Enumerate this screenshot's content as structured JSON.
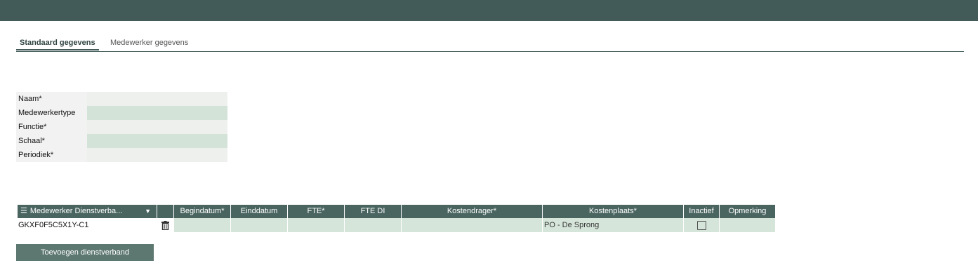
{
  "tabs": [
    {
      "label": "Standaard gegevens",
      "active": true
    },
    {
      "label": "Medewerker gegevens",
      "active": false
    }
  ],
  "form": {
    "fields": [
      {
        "label": "Naam*",
        "value": ""
      },
      {
        "label": "Medewerkertype",
        "value": ""
      },
      {
        "label": "Functie*",
        "value": ""
      },
      {
        "label": "Schaal*",
        "value": ""
      },
      {
        "label": "Periodiek*",
        "value": ""
      }
    ]
  },
  "grid": {
    "columns": [
      "Medewerker Dienstverba...",
      "",
      "Begindatum*",
      "Einddatum",
      "FTE*",
      "FTE DI",
      "Kostendrager*",
      "Kostenplaats*",
      "Inactief",
      "Opmerking"
    ],
    "rows": [
      {
        "code": "GKXF0F5C5X1Y-C1",
        "begindatum": "",
        "einddatum": "",
        "fte": "",
        "fte_di": "",
        "kostendrager": "",
        "kostenplaats": "PO - De Sprong",
        "inactief": false,
        "opmerking": ""
      }
    ]
  },
  "add_button_label": "Toevoegen dienstverband",
  "icons": {
    "menu": "hamburger-icon",
    "caret": "caret-down-icon",
    "delete": "trash-icon"
  },
  "colors": {
    "header": "#425b58",
    "accent_green": "#d3e3d8",
    "button": "#5d7771"
  }
}
